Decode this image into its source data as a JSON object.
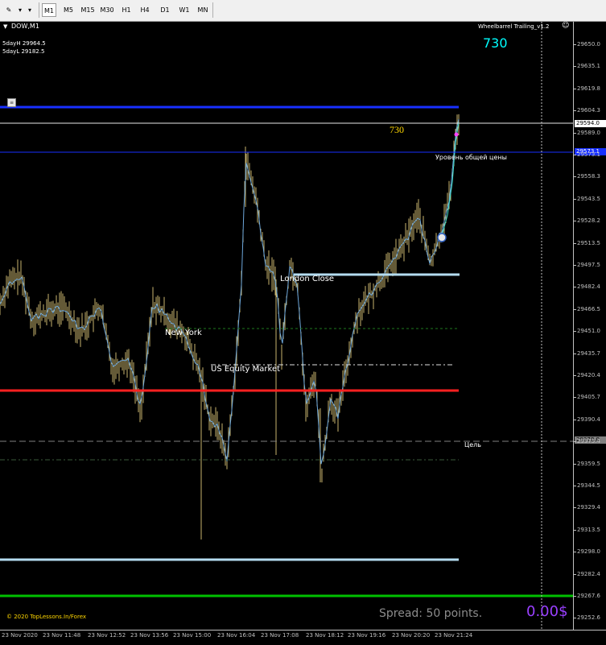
{
  "toolbar": {
    "timeframes": [
      "M1",
      "M5",
      "M15",
      "M30",
      "H1",
      "H4",
      "D1",
      "W1",
      "MN"
    ],
    "active": "M1"
  },
  "chart": {
    "symbol_title": "DOW,M1",
    "day_high": "5dayH 29964.5",
    "day_low": "5dayL 29182.5",
    "indicator_name": "Wheelbarrel Trailing_v1.2",
    "counter_cyan": "730",
    "counter_yellow": "730",
    "level_label": "Уровень общей цены",
    "london_close": "London Close",
    "new_york": "New York",
    "us_equity": "US Equity Market",
    "target_label": "Цель",
    "copyright": "© 2020 TopLessons.In/Forex",
    "spread": "Spread: 50 points.",
    "profit": "0.00$",
    "current_price": "29594.0",
    "blue_price": "29573.1",
    "target_price": "29378.0"
  },
  "colors": {
    "background": "#000000",
    "candles": "#c8b46e",
    "ma": "#6ea8dc",
    "red_line": "#ff2020",
    "blue_line": "#1830ff",
    "light_blue_line": "#b4dcf0",
    "green_line": "#00c000",
    "cyan_text": "#00ffff",
    "yellow_text": "#ffd700",
    "purple_text": "#9a40ff"
  },
  "price_axis": [
    "29650.0",
    "29635.1",
    "29619.8",
    "29604.3",
    "29589.0",
    "29573.1",
    "29558.3",
    "29543.5",
    "29528.2",
    "29513.5",
    "29497.5",
    "29482.4",
    "29466.5",
    "29451.0",
    "29435.7",
    "29420.4",
    "29405.7",
    "29390.4",
    "29375.4",
    "29359.5",
    "29344.5",
    "29329.4",
    "29313.5",
    "29298.0",
    "29282.4",
    "29267.6",
    "29252.6"
  ],
  "time_axis": [
    "23 Nov 2020",
    "23 Nov 11:48",
    "23 Nov 12:52",
    "23 Nov 13:56",
    "23 Nov 15:00",
    "23 Nov 16:04",
    "23 Nov 17:08",
    "23 Nov 18:12",
    "23 Nov 19:16",
    "23 Nov 20:20",
    "23 Nov 21:24"
  ]
}
